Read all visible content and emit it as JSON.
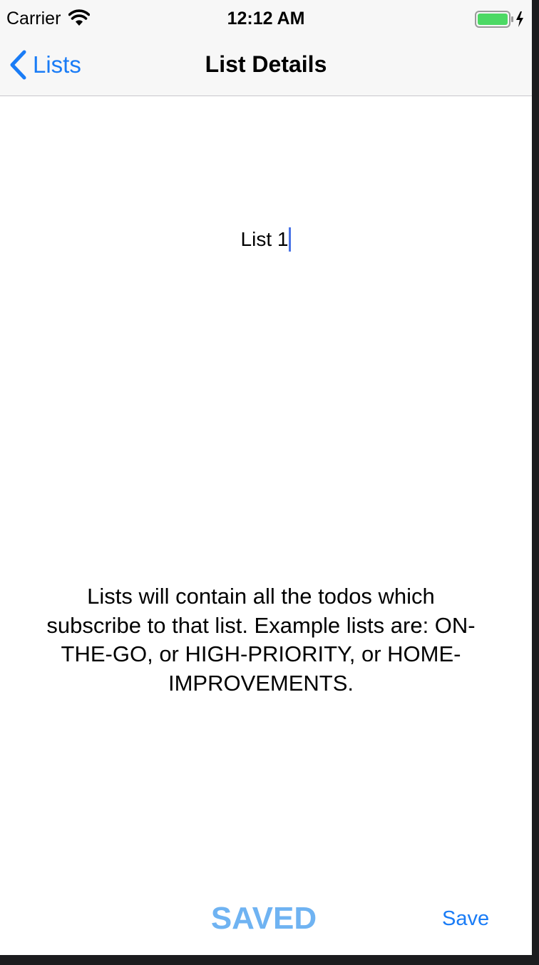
{
  "status_bar": {
    "carrier": "Carrier",
    "time": "12:12 AM",
    "battery_color": "#4cd964"
  },
  "nav_bar": {
    "back_label": "Lists",
    "title": "List Details"
  },
  "list_name_field": {
    "value": "List 1"
  },
  "description": "Lists will contain all the todos which subscribe to that list.  Example lists are: ON-THE-GO, or HIGH-PRIORITY, or HOME-IMPROVEMENTS.",
  "toolbar": {
    "status_label": "SAVED",
    "save_label": "Save"
  },
  "colors": {
    "accent": "#1a7cf6",
    "saved": "#6fb3f2",
    "caret": "#4a74e6"
  }
}
